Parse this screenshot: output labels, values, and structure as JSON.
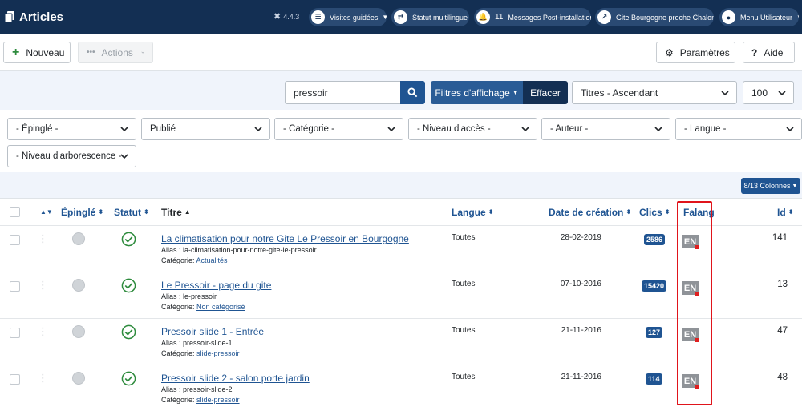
{
  "header": {
    "title": "Articles",
    "version": "4.4.3",
    "pills": [
      {
        "label": "Visites guidées",
        "icon": "signpost-icon",
        "count": ""
      },
      {
        "label": "Statut multilingue",
        "icon": "language-icon",
        "count": ""
      },
      {
        "label": "Messages Post-installation",
        "icon": "bell-icon",
        "count": "11"
      },
      {
        "label": "Gite Bourgogne proche Chalon...",
        "icon": "external-link-icon",
        "count": ""
      },
      {
        "label": "Menu Utilisateur",
        "icon": "user-icon",
        "count": ""
      }
    ]
  },
  "toolbar": {
    "new_label": "Nouveau",
    "actions_label": "Actions",
    "options_label": "Paramètres",
    "help_label": "Aide"
  },
  "search": {
    "value": "pressoir",
    "filters_label": "Filtres d'affichage",
    "clear_label": "Effacer",
    "ordering": "Titres - Ascendant",
    "limit": "100"
  },
  "filters": [
    "- Épinglé -",
    "Publié",
    "- Catégorie -",
    "- Niveau d'accès -",
    "- Auteur -",
    "- Langue -",
    "- Niveau d'arborescence -"
  ],
  "columns_button": "8/13 Colonnes",
  "table": {
    "headers": {
      "featured": "Épinglé",
      "status": "Statut",
      "title": "Titre",
      "language": "Langue",
      "date": "Date de création",
      "hits": "Clics",
      "falang": "Falang",
      "id": "Id"
    },
    "alias_prefix": "Alias : ",
    "category_prefix": "Catégorie: ",
    "rows": [
      {
        "title": "La climatisation pour notre Gite Le Pressoir en Bourgogne",
        "alias": "la-climatisation-pour-notre-gite-le-pressoir",
        "category": "Actualités",
        "language": "Toutes",
        "date": "28-02-2019",
        "hits": "2586",
        "falang": "EN",
        "id": "141"
      },
      {
        "title": "Le Pressoir - page du gite",
        "alias": "le-pressoir",
        "category": "Non catégorisé",
        "language": "Toutes",
        "date": "07-10-2016",
        "hits": "15420",
        "falang": "EN",
        "id": "13"
      },
      {
        "title": "Pressoir slide 1 - Entrée",
        "alias": "pressoir-slide-1",
        "category": "slide-pressoir",
        "language": "Toutes",
        "date": "21-11-2016",
        "hits": "127",
        "falang": "EN",
        "id": "47"
      },
      {
        "title": "Pressoir slide 2 - salon porte jardin",
        "alias": "pressoir-slide-2",
        "category": "slide-pressoir",
        "language": "Toutes",
        "date": "21-11-2016",
        "hits": "114",
        "falang": "EN",
        "id": "48"
      }
    ]
  },
  "colors": {
    "header_bg": "#132f53",
    "accent": "#1f5492",
    "highlight_border": "#e0141b",
    "published_green": "#2e8b3d"
  }
}
